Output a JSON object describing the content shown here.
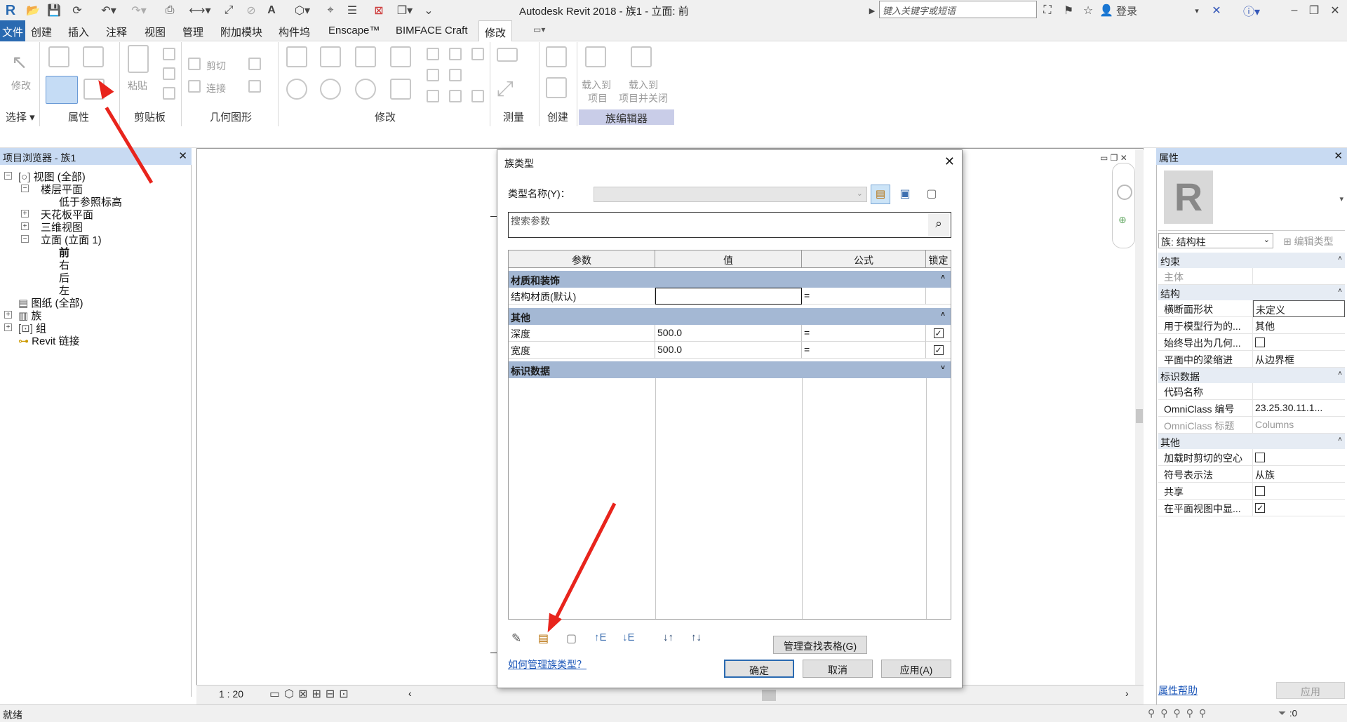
{
  "window": {
    "title": "Autodesk Revit 2018 -    族1 - 立面: 前",
    "search_placeholder": "键入关键字或短语",
    "login": "登录"
  },
  "ribbon": {
    "tabs": [
      "文件",
      "创建",
      "插入",
      "注释",
      "视图",
      "管理",
      "附加模块",
      "构件坞",
      "Enscape™",
      "BIMFACE Craft",
      "修改"
    ],
    "buttons": {
      "modify": "修改",
      "paste": "粘贴",
      "cut": "剪切",
      "join": "连接",
      "load_project": [
        "载入到",
        "项目"
      ],
      "load_close": [
        "载入到",
        "项目并关闭"
      ]
    },
    "panels": [
      "选择",
      "属性",
      "剪贴板",
      "几何图形",
      "修改",
      "测量",
      "创建",
      "族编辑器"
    ]
  },
  "project_browser": {
    "title": "项目浏览器 - 族1",
    "tree": [
      "视图 (全部)",
      "楼层平面",
      "低于参照标高",
      "天花板平面",
      "三维视图",
      "立面 (立面 1)",
      "前",
      "右",
      "后",
      "左",
      "图纸 (全部)",
      "族",
      "组",
      "Revit 链接"
    ]
  },
  "view": {
    "scale": "1 : 20"
  },
  "dialog": {
    "title": "族类型",
    "type_name_label": "类型名称(Y)：",
    "type_name_value": "",
    "search_placeholder": "搜索参数",
    "columns": [
      "参数",
      "值",
      "公式",
      "锁定"
    ],
    "groups": [
      {
        "name": "材质和装饰",
        "rows": [
          {
            "param": "结构材质(默认)",
            "value": "",
            "formula": "=",
            "locked": null
          }
        ]
      },
      {
        "name": "其他",
        "rows": [
          {
            "param": "深度",
            "value": "500.0",
            "formula": "=",
            "locked": true
          },
          {
            "param": "宽度",
            "value": "500.0",
            "formula": "=",
            "locked": true
          }
        ]
      },
      {
        "name": "标识数据",
        "rows": []
      }
    ],
    "manage_lookup": "管理查找表格(G)",
    "help_link": "如何管理族类型？",
    "ok": "确定",
    "cancel": "取消",
    "apply": "应用(A)"
  },
  "properties": {
    "title": "属性",
    "family_selector": "族: 结构柱",
    "edit_type": "编辑类型",
    "groups": [
      {
        "name": "约束",
        "rows": [
          {
            "name": "主体",
            "value": ""
          }
        ]
      },
      {
        "name": "结构",
        "rows": [
          {
            "name": "横断面形状",
            "value": "未定义"
          },
          {
            "name": "用于模型行为的...",
            "value": "其他"
          },
          {
            "name": "始终导出为几何...",
            "value": "",
            "check": false
          },
          {
            "name": "平面中的梁缩进",
            "value": "从边界框"
          }
        ]
      },
      {
        "name": "标识数据",
        "rows": [
          {
            "name": "代码名称",
            "value": ""
          },
          {
            "name": "OmniClass 编号",
            "value": "23.25.30.11.1..."
          },
          {
            "name": "OmniClass 标题",
            "value": "Columns"
          }
        ]
      },
      {
        "name": "其他",
        "rows": [
          {
            "name": "加载时剪切的空心",
            "value": "",
            "check": false
          },
          {
            "name": "符号表示法",
            "value": "从族"
          },
          {
            "name": "共享",
            "value": "",
            "check": false
          },
          {
            "name": "在平面视图中显...",
            "value": "",
            "check": true
          }
        ]
      }
    ],
    "help_link": "属性帮助",
    "apply": "应用"
  },
  "status": {
    "text": "就绪",
    "filter_count": ":0"
  },
  "colors": {
    "accent_blue": "#2a6ab1",
    "panel_header": "#c8daf2",
    "table_group": "#a4b8d4",
    "annotation_red": "#e8241c"
  }
}
